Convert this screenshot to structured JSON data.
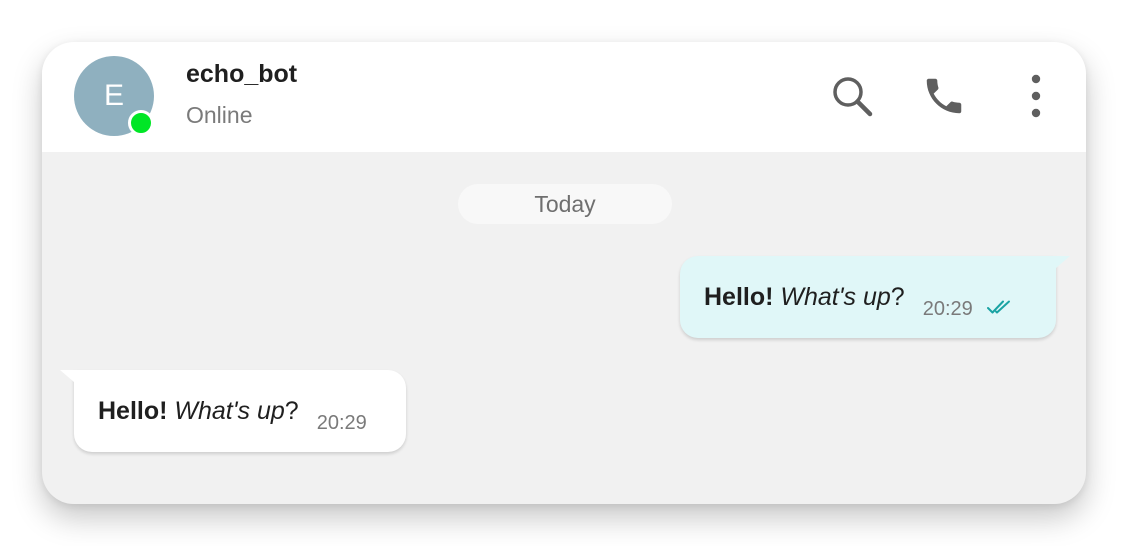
{
  "header": {
    "avatar_letter": "E",
    "contact_name": "echo_bot",
    "status": "Online",
    "status_color": "#00e626",
    "avatar_color": "#8fb0bf",
    "icons": [
      "search-icon",
      "phone-icon",
      "more-vertical-icon"
    ]
  },
  "chat": {
    "date_separator": "Today",
    "messages": [
      {
        "direction": "outgoing",
        "bold": "Hello!",
        "italic": "What's up",
        "plain": "?",
        "time": "20:29",
        "status_icon": "double-check-icon",
        "bubble_color": "#e0f7f8"
      },
      {
        "direction": "incoming",
        "bold": "Hello!",
        "italic": "What's up",
        "plain": "?",
        "time": "20:29",
        "bubble_color": "#ffffff"
      }
    ]
  },
  "colors": {
    "accent": "#1aa3a3",
    "background": "#f1f1f1"
  }
}
